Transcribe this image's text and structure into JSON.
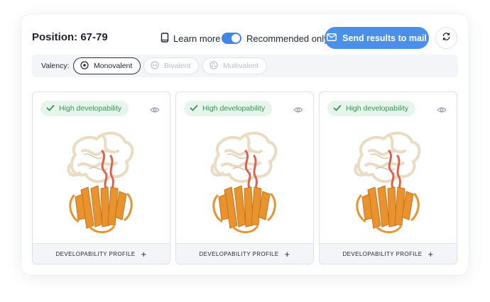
{
  "header": {
    "title": "Position: 67-79",
    "learn_more": "Learn more",
    "recommended_only": "Recommended only",
    "send_button": "Send results to mail"
  },
  "valency": {
    "label": "Valency:",
    "options": [
      {
        "label": "Monovalent",
        "selected": true
      },
      {
        "label": "Bivalent",
        "selected": false
      },
      {
        "label": "Multivalent",
        "selected": false
      }
    ]
  },
  "cards": [
    {
      "badge": "High developability",
      "footer": "DEVELOPABILITY PROFILE"
    },
    {
      "badge": "High developability",
      "footer": "DEVELOPABILITY PROFILE"
    },
    {
      "badge": "High developability",
      "footer": "DEVELOPABILITY PROFILE"
    }
  ],
  "colors": {
    "accent": "#4a90e8",
    "badge_bg": "#e8f5ec",
    "badge_text": "#2e9a4e",
    "protein_top": "#eadbc3",
    "protein_loop": "#e0614b",
    "protein_bottom": "#e8932e"
  },
  "icons": {
    "learn_more": "book-icon",
    "send": "mail-icon",
    "refresh": "refresh-icon",
    "badge": "check-icon",
    "preview": "eye-icon"
  }
}
